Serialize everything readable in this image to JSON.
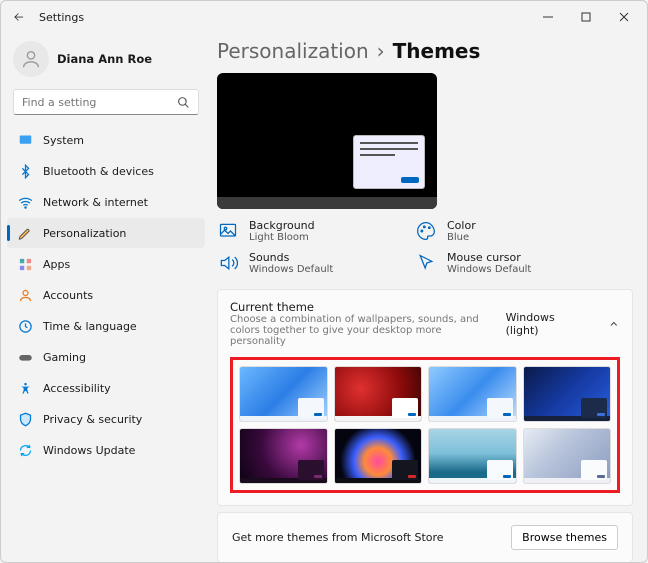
{
  "window": {
    "title": "Settings"
  },
  "user": {
    "name": "Diana Ann Roe"
  },
  "search": {
    "placeholder": "Find a setting"
  },
  "nav": {
    "system": "System",
    "bluetooth": "Bluetooth & devices",
    "network": "Network & internet",
    "personalization": "Personalization",
    "apps": "Apps",
    "accounts": "Accounts",
    "time": "Time & language",
    "gaming": "Gaming",
    "accessibility": "Accessibility",
    "privacy": "Privacy & security",
    "update": "Windows Update"
  },
  "breadcrumb": {
    "parent": "Personalization",
    "sep": "›",
    "current": "Themes"
  },
  "props": {
    "background": {
      "label": "Background",
      "value": "Light Bloom"
    },
    "color": {
      "label": "Color",
      "value": "Blue"
    },
    "sounds": {
      "label": "Sounds",
      "value": "Windows Default"
    },
    "cursor": {
      "label": "Mouse cursor",
      "value": "Windows Default"
    }
  },
  "current_theme": {
    "title": "Current theme",
    "desc": "Choose a combination of wallpapers, sounds, and colors together to give your desktop more personality",
    "value": "Windows (light)"
  },
  "themes": [
    {
      "bg": "linear-gradient(135deg,#6bb8ff 0%,#2b7ee6 50%,#a9d6ff 100%)",
      "winbg": "#f4f7fc",
      "btn": "#0067c0",
      "tb": "#eef3fa"
    },
    {
      "bg": "radial-gradient(circle at 30% 40%, #e03030 0%, #8b0a0a 60%, #3a0606 100%)",
      "winbg": "#fff",
      "btn": "#0067c0",
      "tb": "#f4f4f4"
    },
    {
      "bg": "linear-gradient(135deg,#8fcaff 0%,#3a8dee 50%,#c0e0ff 100%)",
      "winbg": "#f4f7fc",
      "btn": "#0067c0",
      "tb": "#eef3fa"
    },
    {
      "bg": "linear-gradient(135deg,#0a1a4a 0%,#153aa3 50%,#2a5fe0 100%)",
      "winbg": "#1d2b4a",
      "btn": "#3d6fd8",
      "tb": "#16223d"
    },
    {
      "bg": "radial-gradient(circle at 70% 30%, #b23aa8 0%, #3a0a3e 55%, #0a0210 100%)",
      "winbg": "#2a0f2e",
      "btn": "#7a2a70",
      "tb": "#1a0a1d"
    },
    {
      "bg": "radial-gradient(circle at 50% 60%, #ff4aa0 0%, #ff8a3a 25%, #3a5fff 45%, #050510 70%)",
      "winbg": "#15151f",
      "btn": "#d02a2a",
      "tb": "#0d0d14"
    },
    {
      "bg": "linear-gradient(180deg,#a8d4e6 0%,#7dc0d9 45%,#1a6a8a 80%)",
      "winbg": "#f7fbfd",
      "btn": "#0067c0",
      "tb": "#eef5f8"
    },
    {
      "bg": "linear-gradient(135deg,#e6ecf4 0%,#b8c4da 40%,#8a9bc0 100%)",
      "winbg": "#fafbfd",
      "btn": "#5a6b90",
      "tb": "#eef0f6"
    }
  ],
  "store": {
    "text": "Get more themes from Microsoft Store",
    "button": "Browse themes"
  }
}
